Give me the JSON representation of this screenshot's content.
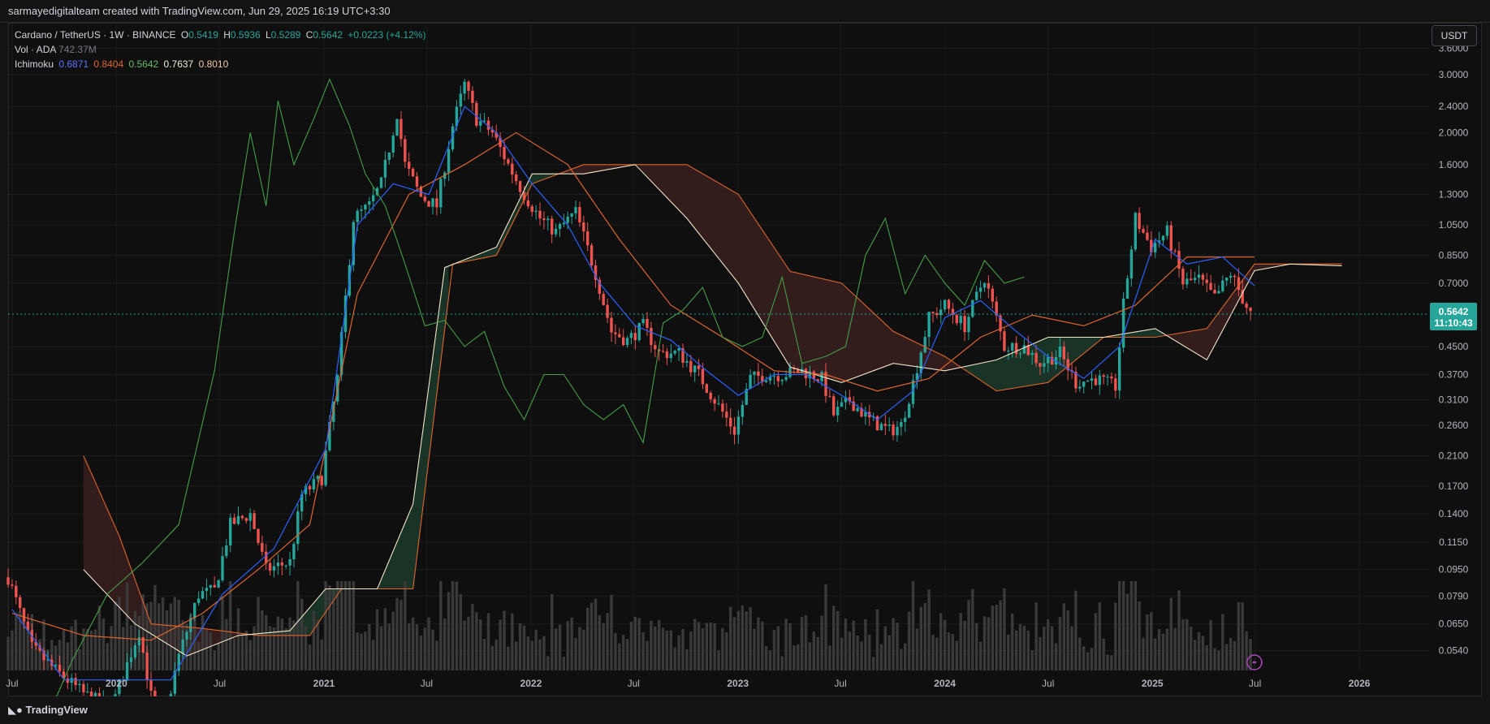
{
  "header": {
    "attribution": "sarmayedigitalteam created with TradingView.com, Jun 29, 2025 16:19 UTC+3:30"
  },
  "legend": {
    "symbol": "Cardano / TetherUS · 1W · BINANCE",
    "open_label": "O",
    "open": "0.5419",
    "high_label": "H",
    "high": "0.5936",
    "low_label": "L",
    "low": "0.5289",
    "close_label": "C",
    "close": "0.5642",
    "change": "+0.0223 (+4.12%)",
    "vol_label": "Vol · ADA",
    "vol_value": "742.37M",
    "ichimoku_label": "Ichimoku",
    "ichimoku_values": [
      "0.6871",
      "0.8404",
      "0.5642",
      "0.7637",
      "0.8010"
    ]
  },
  "currency": "USDT",
  "footer": {
    "logo_text": "TradingView"
  },
  "colors": {
    "up": "#26a69a",
    "down": "#ef5350",
    "conversion": "#2962ff",
    "base": "#e0652d",
    "lagging": "#43a047",
    "spanA": "#f3e6c9",
    "spanB": "#f4ead6",
    "cloud_bull": "#1b3a2a",
    "cloud_bear": "#3a1f1f",
    "price_box": "#26a69a",
    "event": "#ab47bc"
  },
  "chart_data": {
    "type": "candlestick",
    "scale": "log",
    "x_ticks": [
      "Jul",
      "2020",
      "Jul",
      "2021",
      "Jul",
      "2022",
      "Jul",
      "2023",
      "Jul",
      "2024",
      "Jul",
      "2025",
      "Jul",
      "2026"
    ],
    "x_tick_dates": [
      "2019-07-01",
      "2020-01-01",
      "2020-07-01",
      "2021-01-01",
      "2021-07-01",
      "2022-01-01",
      "2022-07-01",
      "2023-01-01",
      "2023-07-01",
      "2024-01-01",
      "2024-07-01",
      "2025-01-01",
      "2025-07-01",
      "2026-01-01"
    ],
    "y_ticks": [
      3.6,
      3.0,
      2.4,
      2.0,
      1.6,
      1.3,
      1.05,
      0.85,
      0.7,
      0.45,
      0.37,
      0.31,
      0.26,
      0.21,
      0.17,
      0.14,
      0.115,
      0.095,
      0.079,
      0.065,
      0.054
    ],
    "y_tick_labels": [
      "3.6000",
      "3.0000",
      "2.4000",
      "2.0000",
      "1.6000",
      "1.3000",
      "1.0500",
      "0.8500",
      "0.7000",
      "0.4500",
      "0.3700",
      "0.3100",
      "0.2600",
      "0.2100",
      "0.1700",
      "0.1400",
      "0.1150",
      "0.0950",
      "0.0790",
      "0.0650",
      "0.0540"
    ],
    "ylim": [
      0.047,
      3.8
    ],
    "last_price": 0.5642,
    "last_price_label": "0.5642",
    "countdown": "11:10:43",
    "close_path": [
      [
        "2019-06-24",
        0.09
      ],
      [
        "2019-08-05",
        0.055
      ],
      [
        "2019-09-16",
        0.047
      ],
      [
        "2019-11-04",
        0.04
      ],
      [
        "2019-12-23",
        0.036
      ],
      [
        "2020-02-10",
        0.062
      ],
      [
        "2020-03-16",
        0.029
      ],
      [
        "2020-04-20",
        0.052
      ],
      [
        "2020-05-25",
        0.08
      ],
      [
        "2020-06-22",
        0.082
      ],
      [
        "2020-07-20",
        0.13
      ],
      [
        "2020-08-24",
        0.14
      ],
      [
        "2020-09-21",
        0.095
      ],
      [
        "2020-11-02",
        0.1
      ],
      [
        "2020-11-23",
        0.16
      ],
      [
        "2020-12-28",
        0.18
      ],
      [
        "2021-01-25",
        0.36
      ],
      [
        "2021-02-22",
        1.1
      ],
      [
        "2021-03-22",
        1.2
      ],
      [
        "2021-04-12",
        1.4
      ],
      [
        "2021-05-10",
        2.3
      ],
      [
        "2021-05-24",
        1.6
      ],
      [
        "2021-06-21",
        1.28
      ],
      [
        "2021-07-19",
        1.2
      ],
      [
        "2021-08-16",
        2.1
      ],
      [
        "2021-09-06",
        2.8
      ],
      [
        "2021-09-27",
        2.2
      ],
      [
        "2021-10-25",
        2.0
      ],
      [
        "2021-11-22",
        1.6
      ],
      [
        "2021-12-20",
        1.3
      ],
      [
        "2022-01-17",
        1.1
      ],
      [
        "2022-02-14",
        1.0
      ],
      [
        "2022-03-21",
        1.15
      ],
      [
        "2022-04-25",
        0.75
      ],
      [
        "2022-05-23",
        0.5
      ],
      [
        "2022-06-20",
        0.47
      ],
      [
        "2022-07-18",
        0.52
      ],
      [
        "2022-08-15",
        0.43
      ],
      [
        "2022-09-19",
        0.43
      ],
      [
        "2022-10-24",
        0.37
      ],
      [
        "2022-11-21",
        0.31
      ],
      [
        "2022-12-26",
        0.25
      ],
      [
        "2023-01-23",
        0.36
      ],
      [
        "2023-02-20",
        0.37
      ],
      [
        "2023-03-20",
        0.37
      ],
      [
        "2023-04-24",
        0.38
      ],
      [
        "2023-05-29",
        0.36
      ],
      [
        "2023-06-19",
        0.28
      ],
      [
        "2023-07-17",
        0.31
      ],
      [
        "2023-08-21",
        0.27
      ],
      [
        "2023-09-25",
        0.25
      ],
      [
        "2023-10-16",
        0.26
      ],
      [
        "2023-11-06",
        0.35
      ],
      [
        "2023-12-04",
        0.55
      ],
      [
        "2024-01-01",
        0.6
      ],
      [
        "2024-02-05",
        0.52
      ],
      [
        "2024-03-11",
        0.73
      ],
      [
        "2024-04-15",
        0.45
      ],
      [
        "2024-05-20",
        0.45
      ],
      [
        "2024-06-17",
        0.4
      ],
      [
        "2024-07-22",
        0.43
      ],
      [
        "2024-08-19",
        0.35
      ],
      [
        "2024-09-23",
        0.36
      ],
      [
        "2024-10-28",
        0.34
      ],
      [
        "2024-11-11",
        0.6
      ],
      [
        "2024-12-02",
        1.1
      ],
      [
        "2024-12-30",
        0.9
      ],
      [
        "2025-01-27",
        1.0
      ],
      [
        "2025-02-24",
        0.7
      ],
      [
        "2025-03-24",
        0.72
      ],
      [
        "2025-04-21",
        0.63
      ],
      [
        "2025-05-19",
        0.75
      ],
      [
        "2025-06-09",
        0.63
      ],
      [
        "2025-06-23",
        0.5642
      ]
    ],
    "tenkan_path": [
      [
        "2019-07-01",
        0.072
      ],
      [
        "2019-10-01",
        0.044
      ],
      [
        "2020-01-06",
        0.044
      ],
      [
        "2020-04-06",
        0.044
      ],
      [
        "2020-07-06",
        0.08
      ],
      [
        "2020-10-05",
        0.11
      ],
      [
        "2021-01-04",
        0.22
      ],
      [
        "2021-03-01",
        1.05
      ],
      [
        "2021-05-03",
        1.4
      ],
      [
        "2021-07-05",
        1.3
      ],
      [
        "2021-09-06",
        2.4
      ],
      [
        "2021-11-01",
        2.0
      ],
      [
        "2022-01-03",
        1.4
      ],
      [
        "2022-03-07",
        1.05
      ],
      [
        "2022-05-02",
        0.7
      ],
      [
        "2022-07-04",
        0.52
      ],
      [
        "2022-09-05",
        0.47
      ],
      [
        "2022-11-07",
        0.38
      ],
      [
        "2023-01-02",
        0.32
      ],
      [
        "2023-03-06",
        0.37
      ],
      [
        "2023-05-01",
        0.37
      ],
      [
        "2023-07-03",
        0.32
      ],
      [
        "2023-09-04",
        0.27
      ],
      [
        "2023-11-06",
        0.33
      ],
      [
        "2024-01-01",
        0.55
      ],
      [
        "2024-03-04",
        0.62
      ],
      [
        "2024-05-06",
        0.5
      ],
      [
        "2024-07-01",
        0.42
      ],
      [
        "2024-09-02",
        0.36
      ],
      [
        "2024-11-04",
        0.45
      ],
      [
        "2025-01-06",
        0.95
      ],
      [
        "2025-03-03",
        0.8
      ],
      [
        "2025-05-05",
        0.84
      ],
      [
        "2025-06-30",
        0.6871
      ]
    ],
    "kijun_path": [
      [
        "2019-07-01",
        0.07
      ],
      [
        "2019-11-04",
        0.06
      ],
      [
        "2020-03-02",
        0.058
      ],
      [
        "2020-06-01",
        0.07
      ],
      [
        "2020-09-07",
        0.095
      ],
      [
        "2020-12-07",
        0.13
      ],
      [
        "2021-03-01",
        0.65
      ],
      [
        "2021-05-31",
        1.3
      ],
      [
        "2021-09-06",
        1.6
      ],
      [
        "2021-12-06",
        2.0
      ],
      [
        "2022-03-07",
        1.6
      ],
      [
        "2022-06-06",
        0.95
      ],
      [
        "2022-09-05",
        0.6
      ],
      [
        "2022-12-05",
        0.48
      ],
      [
        "2023-03-06",
        0.38
      ],
      [
        "2023-06-05",
        0.37
      ],
      [
        "2023-09-04",
        0.33
      ],
      [
        "2023-12-04",
        0.36
      ],
      [
        "2024-03-04",
        0.48
      ],
      [
        "2024-06-03",
        0.56
      ],
      [
        "2024-09-02",
        0.52
      ],
      [
        "2024-12-02",
        0.6
      ],
      [
        "2025-03-03",
        0.84
      ],
      [
        "2025-06-30",
        0.8404
      ]
    ],
    "lagging_path": [
      [
        "2019-06-24",
        0.03
      ],
      [
        "2019-08-12",
        0.028
      ],
      [
        "2019-10-14",
        0.05
      ],
      [
        "2019-12-16",
        0.08
      ],
      [
        "2020-02-17",
        0.1
      ],
      [
        "2020-04-20",
        0.13
      ],
      [
        "2020-06-22",
        0.38
      ],
      [
        "2020-07-27",
        1.0
      ],
      [
        "2020-08-24",
        2.0
      ],
      [
        "2020-09-21",
        1.2
      ],
      [
        "2020-10-12",
        2.5
      ],
      [
        "2020-11-09",
        1.6
      ],
      [
        "2020-12-14",
        2.2
      ],
      [
        "2021-01-11",
        2.9
      ],
      [
        "2021-02-15",
        2.1
      ],
      [
        "2021-03-15",
        1.5
      ],
      [
        "2021-04-19",
        1.2
      ],
      [
        "2021-05-24",
        0.8
      ],
      [
        "2021-06-28",
        0.52
      ],
      [
        "2021-08-02",
        0.54
      ],
      [
        "2021-09-06",
        0.45
      ],
      [
        "2021-10-11",
        0.5
      ],
      [
        "2021-11-15",
        0.34
      ],
      [
        "2021-12-20",
        0.27
      ],
      [
        "2022-01-24",
        0.37
      ],
      [
        "2022-02-28",
        0.37
      ],
      [
        "2022-04-04",
        0.3
      ],
      [
        "2022-05-09",
        0.27
      ],
      [
        "2022-06-13",
        0.3
      ],
      [
        "2022-07-18",
        0.23
      ],
      [
        "2022-08-22",
        0.53
      ],
      [
        "2022-09-26",
        0.58
      ],
      [
        "2022-10-31",
        0.68
      ],
      [
        "2022-12-05",
        0.48
      ],
      [
        "2023-01-09",
        0.45
      ],
      [
        "2023-02-13",
        0.48
      ],
      [
        "2023-03-20",
        0.73
      ],
      [
        "2023-04-24",
        0.4
      ],
      [
        "2023-06-05",
        0.42
      ],
      [
        "2023-07-10",
        0.45
      ],
      [
        "2023-08-14",
        0.85
      ],
      [
        "2023-09-18",
        1.1
      ],
      [
        "2023-10-23",
        0.65
      ],
      [
        "2023-11-27",
        0.85
      ],
      [
        "2024-01-01",
        0.7
      ],
      [
        "2024-02-05",
        0.6
      ],
      [
        "2024-03-11",
        0.82
      ],
      [
        "2024-04-15",
        0.7
      ],
      [
        "2024-05-20",
        0.73
      ]
    ],
    "span_a_path": [
      [
        "2019-11-04",
        0.095
      ],
      [
        "2020-02-03",
        0.065
      ],
      [
        "2020-05-04",
        0.052
      ],
      [
        "2020-08-03",
        0.06
      ],
      [
        "2020-11-02",
        0.062
      ],
      [
        "2021-01-04",
        0.083
      ],
      [
        "2021-04-05",
        0.083
      ],
      [
        "2021-06-07",
        0.15
      ],
      [
        "2021-08-02",
        0.78
      ],
      [
        "2021-11-01",
        0.9
      ],
      [
        "2022-01-03",
        1.5
      ],
      [
        "2022-04-04",
        1.5
      ],
      [
        "2022-07-04",
        1.6
      ],
      [
        "2022-10-03",
        1.1
      ],
      [
        "2023-01-02",
        0.7
      ],
      [
        "2023-04-03",
        0.39
      ],
      [
        "2023-07-03",
        0.35
      ],
      [
        "2023-10-02",
        0.4
      ],
      [
        "2024-01-01",
        0.38
      ],
      [
        "2024-04-01",
        0.41
      ],
      [
        "2024-07-01",
        0.48
      ],
      [
        "2024-10-07",
        0.48
      ],
      [
        "2025-01-06",
        0.51
      ],
      [
        "2025-04-07",
        0.41
      ],
      [
        "2025-06-30",
        0.7637
      ],
      [
        "2025-09-01",
        0.8
      ],
      [
        "2025-12-01",
        0.79
      ]
    ],
    "span_b_path": [
      [
        "2019-11-04",
        0.21
      ],
      [
        "2020-01-06",
        0.12
      ],
      [
        "2020-03-02",
        0.065
      ],
      [
        "2020-06-01",
        0.063
      ],
      [
        "2020-09-07",
        0.06
      ],
      [
        "2020-12-07",
        0.06
      ],
      [
        "2021-02-01",
        0.083
      ],
      [
        "2021-06-07",
        0.083
      ],
      [
        "2021-08-16",
        0.8
      ],
      [
        "2021-11-01",
        0.85
      ],
      [
        "2022-01-03",
        1.4
      ],
      [
        "2022-04-04",
        1.6
      ],
      [
        "2022-07-04",
        1.6
      ],
      [
        "2022-10-03",
        1.6
      ],
      [
        "2023-01-02",
        1.3
      ],
      [
        "2023-04-03",
        0.76
      ],
      [
        "2023-07-03",
        0.7
      ],
      [
        "2023-10-02",
        0.5
      ],
      [
        "2024-01-01",
        0.42
      ],
      [
        "2024-04-01",
        0.33
      ],
      [
        "2024-07-01",
        0.35
      ],
      [
        "2024-10-07",
        0.48
      ],
      [
        "2025-01-06",
        0.48
      ],
      [
        "2025-04-07",
        0.51
      ],
      [
        "2025-06-30",
        0.8
      ],
      [
        "2025-09-01",
        0.8
      ],
      [
        "2025-12-01",
        0.801
      ]
    ]
  }
}
